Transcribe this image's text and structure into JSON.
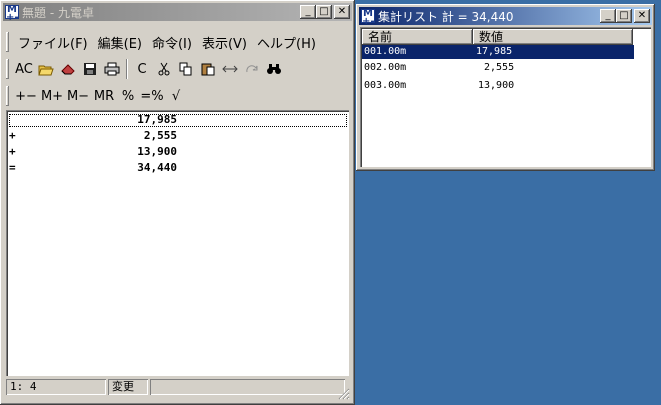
{
  "calc_window": {
    "title": "無題 - 九電卓",
    "menu": [
      "ファイル(F)",
      "編集(E)",
      "命令(I)",
      "表示(V)",
      "ヘルプ(H)"
    ],
    "toolbar1": {
      "ac_label": "AC",
      "clear_label": "C"
    },
    "toolbar2": {
      "buttons": [
        "+−",
        "M+",
        "M−",
        "MR",
        "%",
        "=%",
        "√"
      ]
    },
    "tape": [
      {
        "op": "",
        "value": "17,985"
      },
      {
        "op": "+",
        "value": "2,555"
      },
      {
        "op": "+",
        "value": "13,900"
      },
      {
        "op": "=",
        "value": "34,440"
      }
    ],
    "status": {
      "position": "1: 4",
      "state": "変更"
    }
  },
  "list_window": {
    "title": "集計リスト 計 = 34,440",
    "columns": [
      "名前",
      "数値"
    ],
    "rows": [
      {
        "name": "001.00m",
        "value": "17,985"
      },
      {
        "name": "002.00m",
        "value": "2,555"
      },
      {
        "name": "003.00m",
        "value": "13,900"
      }
    ]
  },
  "colors": {
    "desktop": "#3a6ea5",
    "active_title": "#0a246a",
    "inactive_title": "#808080",
    "selection": "#0a246a"
  }
}
